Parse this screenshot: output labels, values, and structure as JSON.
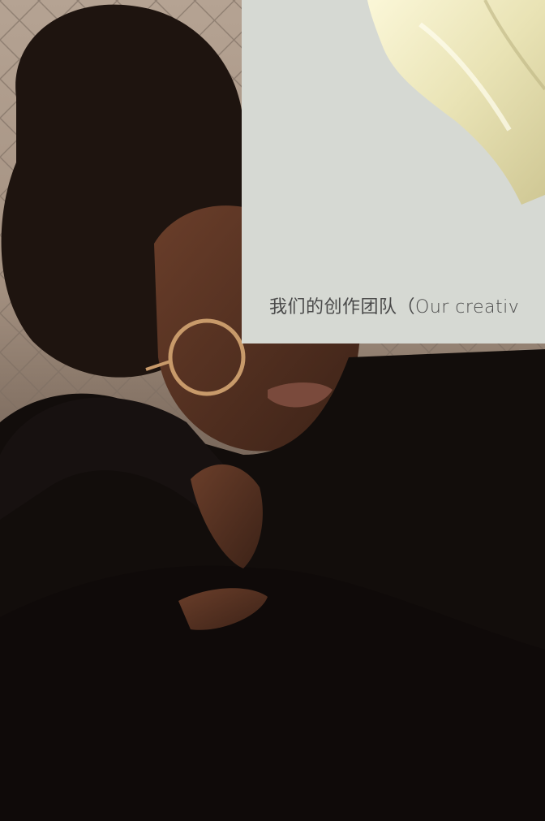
{
  "card": {
    "caption": "我们的创作团队（Our creativ"
  }
}
